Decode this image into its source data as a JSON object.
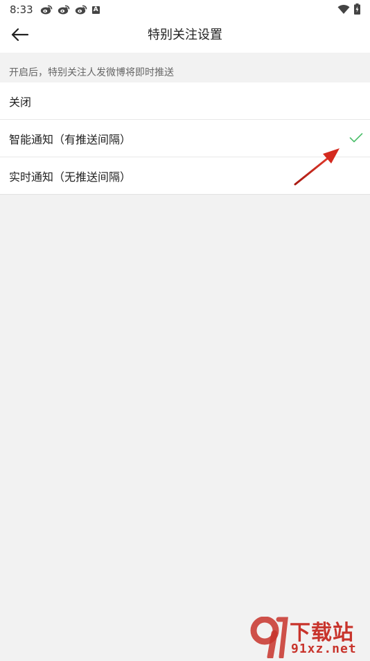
{
  "status_bar": {
    "time": "8:33",
    "left_icons": [
      "weibo-icon",
      "weibo-icon",
      "weibo-icon",
      "notification-a-icon"
    ],
    "notif_badge_text": "A",
    "right_icons": [
      "wifi-icon",
      "battery-charging-icon"
    ]
  },
  "header": {
    "title": "特别关注设置",
    "back_icon": "arrow-left-icon"
  },
  "section": {
    "hint": "开启后，特别关注人发微博将即时推送"
  },
  "options": [
    {
      "label": "关闭",
      "selected": false
    },
    {
      "label": "智能通知（有推送间隔）",
      "selected": true
    },
    {
      "label": "实时通知（无推送间隔）",
      "selected": false
    }
  ],
  "colors": {
    "check": "#4cbf6b",
    "annotation_arrow": "#d42a1f",
    "watermark": "#c8342c"
  },
  "watermark": {
    "logo_text": "9",
    "brand_cn": "下载站",
    "domain": "91xz.net"
  }
}
